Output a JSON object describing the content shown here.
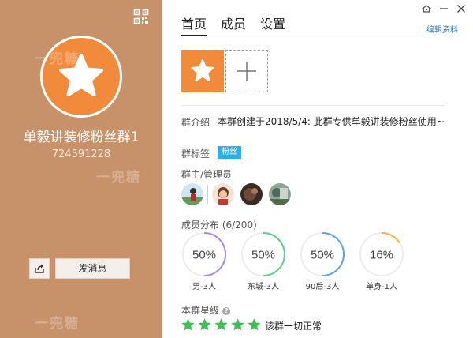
{
  "left": {
    "group_name": "单毅讲装修粉丝群1",
    "group_id": "724591228",
    "send_button": "发消息",
    "watermark": "一兜糖",
    "bg_color": "#c7916a",
    "avatar_color": "#f28a3c"
  },
  "tabs": [
    {
      "label": "首页",
      "active": true
    },
    {
      "label": "成员",
      "active": false
    },
    {
      "label": "设置",
      "active": false
    }
  ],
  "edit_profile": "编辑资料",
  "intro": {
    "label": "群介绍",
    "text": "本群创建于2018/5/4:  此群专供单毅讲装修粉丝使用~"
  },
  "tags": {
    "label": "群标签",
    "items": [
      "粉丝"
    ],
    "color": "#2ab0e8"
  },
  "admins": {
    "label": "群主/管理员",
    "count": 4
  },
  "distribution": {
    "title": "成员分布 (6/200)",
    "items": [
      {
        "value": "50%",
        "label": "男-3人",
        "fraction": 0.5,
        "color": "#a98ae0"
      },
      {
        "value": "50%",
        "label": "东城-3人",
        "fraction": 0.5,
        "color": "#5ccf8a"
      },
      {
        "value": "50%",
        "label": "90后-3人",
        "fraction": 0.5,
        "color": "#5aa6ea"
      },
      {
        "value": "16%",
        "label": "单身-1人",
        "fraction": 0.16,
        "color": "#f2b23a"
      }
    ]
  },
  "level": {
    "label": "本群星级",
    "stars": 5,
    "star_color": "#3fbf55",
    "status": "该群一切正常"
  }
}
